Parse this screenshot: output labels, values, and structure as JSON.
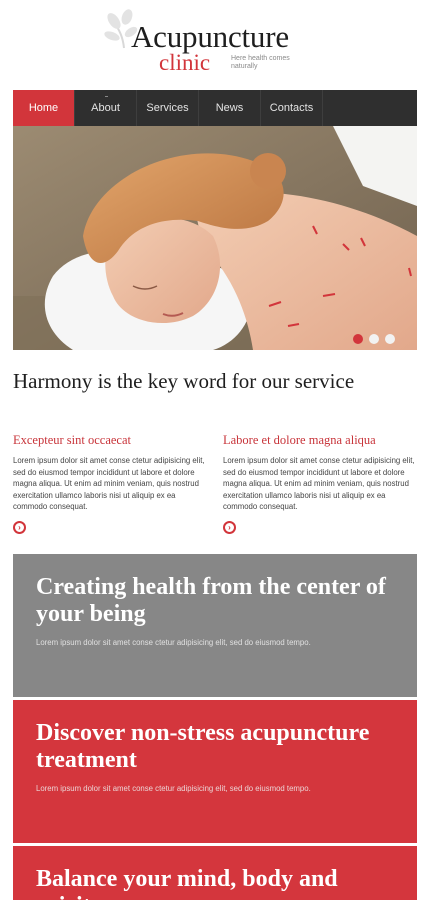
{
  "logo": {
    "title": "Acupuncture",
    "subtitle": "clinic",
    "tagline": "Here health comes naturally"
  },
  "nav": {
    "items": [
      {
        "label": "Home",
        "active": true
      },
      {
        "label": "About",
        "active": false
      },
      {
        "label": "Services",
        "active": false
      },
      {
        "label": "News",
        "active": false
      },
      {
        "label": "Contacts",
        "active": false
      }
    ]
  },
  "slider": {
    "slide_count": 3,
    "active_index": 0
  },
  "intro": {
    "title": "Harmony is the key word for our service",
    "columns": [
      {
        "heading": "Excepteur sint occaecat",
        "text": "Lorem ipsum dolor sit amet conse ctetur adipisicing elit, sed do eiusmod tempor incididunt ut labore et dolore magna aliqua. Ut enim ad minim veniam, quis nostrud exercitation ullamco laboris nisi ut aliquip ex ea commodo consequat."
      },
      {
        "heading": "Labore et dolore magna aliqua",
        "text": "Lorem ipsum dolor sit amet conse ctetur adipisicing elit, sed do eiusmod tempor incididunt ut labore et dolore magna aliqua. Ut enim ad minim veniam, quis nostrud exercitation ullamco laboris nisi ut aliquip ex ea commodo consequat."
      }
    ]
  },
  "banners": [
    {
      "title": "Creating health from the center of your being",
      "text": "Lorem ipsum dolor sit amet conse ctetur adipisicing elit, sed do eiusmod tempo."
    },
    {
      "title": "Discover non-stress acupuncture treatment",
      "text": "Lorem ipsum dolor sit amet conse ctetur adipisicing elit, sed do eiusmod tempo."
    },
    {
      "title": "Balance your mind, body and spirit",
      "text": ""
    }
  ],
  "colors": {
    "accent": "#d2353b",
    "nav_bg": "#2f2f2f",
    "banner_grey": "#878787",
    "banner_red": "#d4363d"
  },
  "icons": {
    "logo_leaf": "leaf-icon",
    "read_more": "circle-arrow-right-icon"
  }
}
